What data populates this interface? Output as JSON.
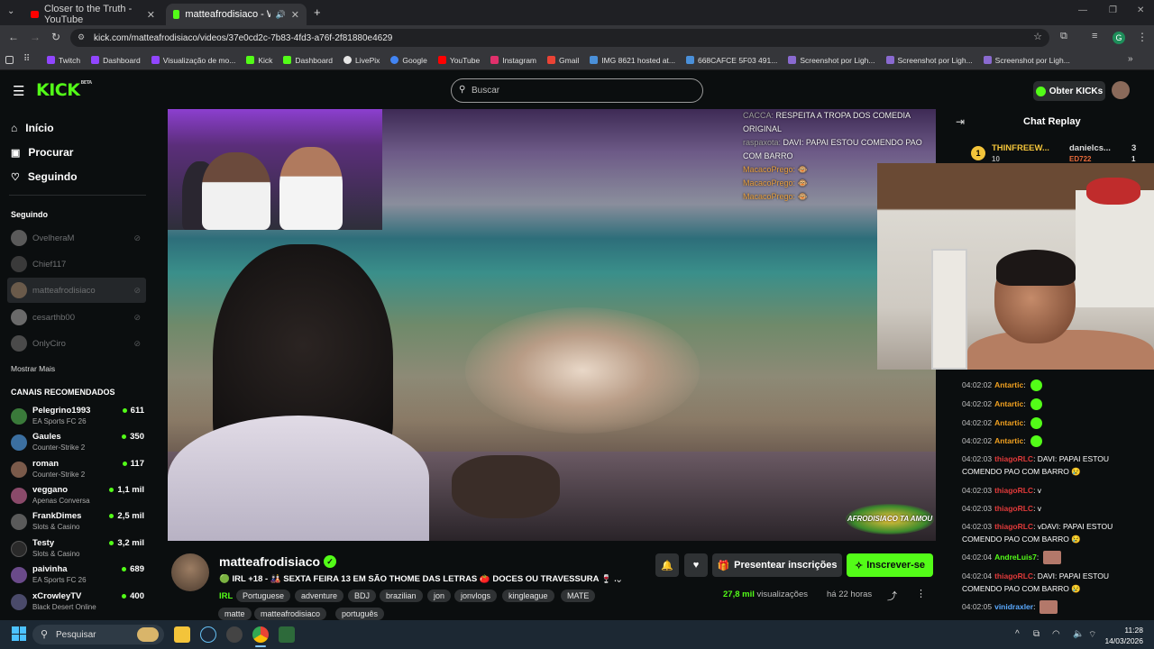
{
  "browser": {
    "tabs": [
      {
        "title": "Closer to the Truth - YouTube",
        "active": false
      },
      {
        "title": "matteafrodisiaco - Watch t",
        "active": true
      }
    ],
    "url": "kick.com/matteafrodisiaco/videos/37e0cd2c-7b83-4fd3-a76f-2f81880e4629",
    "profile_initial": "G",
    "bookmarks": [
      "Twitch",
      "Dashboard",
      "Visualização de mo...",
      "Kick",
      "Dashboard",
      "LivePix",
      "Google",
      "YouTube",
      "Instagram",
      "Gmail",
      "IMG 8621 hosted at...",
      "668CAFCE 5F03 491...",
      "Screenshot por Ligh...",
      "Screenshot por Ligh...",
      "Screenshot por Ligh..."
    ]
  },
  "header": {
    "logo": "KICK",
    "logo_badge": "BETA",
    "search_placeholder": "Buscar",
    "cta": "Obter KICKs"
  },
  "sidebar": {
    "nav": [
      {
        "label": "Início",
        "icon": "home-icon"
      },
      {
        "label": "Procurar",
        "icon": "browse-icon"
      },
      {
        "label": "Seguindo",
        "icon": "heart-icon"
      }
    ],
    "following_title": "Seguindo",
    "following": [
      "OvelheraM",
      "Chief117",
      "matteafrodisiaco",
      "cesarthb00",
      "OnlyCiro"
    ],
    "show_more": "Mostrar Mais",
    "recommended_title": "CANAIS RECOMENDADOS",
    "recommended": [
      {
        "name": "Pelegrino1993",
        "category": "EA Sports FC 26",
        "viewers": "611",
        "color": "#3a7a3a"
      },
      {
        "name": "Gaules",
        "category": "Counter-Strike 2",
        "viewers": "350",
        "color": "#3b6fa0"
      },
      {
        "name": "roman",
        "category": "Counter-Strike 2",
        "viewers": "117",
        "color": "#7a5a4a"
      },
      {
        "name": "veggano",
        "category": "Apenas Conversa",
        "viewers": "1,1 mil",
        "color": "#8a4a6a"
      },
      {
        "name": "FrankDimes",
        "category": "Slots & Casino",
        "viewers": "2,5 mil",
        "color": "#5a5a5a"
      },
      {
        "name": "Testy",
        "category": "Slots & Casino",
        "viewers": "3,2 mil",
        "color": "#2a2a2a"
      },
      {
        "name": "paivinha",
        "category": "EA Sports FC 26",
        "viewers": "689",
        "color": "#6a4a8a"
      },
      {
        "name": "xCrowleyTV",
        "category": "Black Desert Online",
        "viewers": "400",
        "color": "#4a4a6a"
      }
    ]
  },
  "video": {
    "overlay_chat": [
      {
        "user": "CACCA: ",
        "text": "RESPEITA A TROPA DOS COMEDIA ORIGINAL"
      },
      {
        "user": "raspaxota: ",
        "text": "DAVI: PAPAI ESTOU COMENDO PAO COM BARRO"
      },
      {
        "user": "MacacoPrego: ",
        "text": ""
      },
      {
        "user": "MacacoPrego: ",
        "text": ""
      },
      {
        "user": "MacacoPrego: ",
        "text": ""
      }
    ],
    "watermark": "AFRODISIACO TA AMOU"
  },
  "stream": {
    "channel": "matteafrodisiaco",
    "title": "🟢 IRL +18 - 🎎 SEXTA FEIRA 13 EM SÃO THOME DAS LETRAS 🍅 DOCES OU TRAVESSURA 🍷 ...",
    "category": "IRL",
    "tags": [
      "Portuguese",
      "adventure",
      "BDJ",
      "brazilian",
      "jon",
      "jonvlogs",
      "kingleague",
      "MATE",
      "matte",
      "matteafrodisiaco",
      "português"
    ],
    "gift_label": "Presentear inscrições",
    "subscribe_label": "Inscrever-se",
    "views_count": "27,8 mil",
    "views_label": "visualizações",
    "ago": "há 22 horas"
  },
  "chat": {
    "title": "Chat Replay",
    "leaderboard": [
      {
        "rank": "1",
        "name": "THINFREEW...",
        "score": "10"
      },
      {
        "name": "danielcs...",
        "score": "3"
      },
      {
        "name": "ED722",
        "score": "1"
      }
    ],
    "messages": [
      {
        "time": "04:02:02",
        "user": "Antartic",
        "color": "uo",
        "text": "",
        "emote": "green"
      },
      {
        "time": "04:02:02",
        "user": "Antartic",
        "color": "uo",
        "text": "",
        "emote": "green"
      },
      {
        "time": "04:02:02",
        "user": "Antartic",
        "color": "uo",
        "text": "",
        "emote": "green"
      },
      {
        "time": "04:02:02",
        "user": "Antartic",
        "color": "uo",
        "text": "",
        "emote": "green"
      },
      {
        "time": "04:02:03",
        "user": "thiagoRLC",
        "color": "ur",
        "text": "DAVI: PAPAI ESTOU COMENDO PAO COM BARRO 😢",
        "emote": ""
      },
      {
        "time": "04:02:03",
        "user": "thiagoRLC",
        "color": "ur",
        "text": "v",
        "emote": ""
      },
      {
        "time": "04:02:03",
        "user": "thiagoRLC",
        "color": "ur",
        "text": "v",
        "emote": ""
      },
      {
        "time": "04:02:03",
        "user": "thiagoRLC",
        "color": "ur",
        "text": "vDAVI: PAPAI ESTOU COMENDO PAO COM BARRO 😢",
        "emote": ""
      },
      {
        "time": "04:02:04",
        "user": "AndreLuis7",
        "color": "ug",
        "text": "",
        "emote": "img"
      },
      {
        "time": "04:02:04",
        "user": "thiagoRLC",
        "color": "ur",
        "text": "DAVI: PAPAI ESTOU COMENDO PAO COM BARRO 😢",
        "emote": ""
      },
      {
        "time": "04:02:05",
        "user": "vinidraxler",
        "color": "ub",
        "text": "",
        "emote": "img"
      }
    ]
  },
  "taskbar": {
    "search_placeholder": "Pesquisar",
    "time": "11:28",
    "date": "14/03/2026"
  },
  "colors": {
    "kick_green": "#53fc18",
    "background": "#0b0e0f"
  }
}
